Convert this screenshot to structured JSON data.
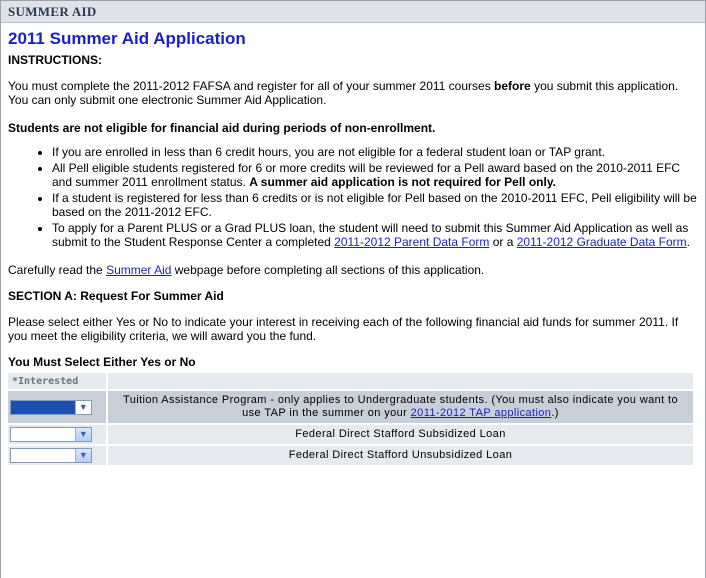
{
  "panel_title": "SUMMER AID",
  "page_title": "2011 Summer Aid Application",
  "instructions_heading": "INSTRUCTIONS:",
  "intro": {
    "part1": "You must complete the 2011-2012 FAFSA and register for all of your summer 2011 courses ",
    "bold": "before",
    "part2": " you submit this application. You can only submit one electronic Summer Aid Application."
  },
  "eligibility_note": "Students are not eligible for financial aid during periods of non-enrollment.",
  "bullets": {
    "b1": "If you are enrolled in less than 6 credit hours, you are not eligible for a federal student loan or TAP grant.",
    "b2_text": "All Pell eligible students registered for 6 or more credits will be reviewed for a Pell award based on the 2010-2011 EFC and summer 2011 enrollment status. ",
    "b2_bold": "A summer aid application is not required for Pell only.",
    "b3": "If a student is registered for less than 6 credits or is not eligible for Pell based on the 2010-2011 EFC, Pell eligibility will be based on the 2011-2012 EFC.",
    "b4_text": "To apply for a Parent PLUS or a Grad PLUS loan, the student will need to submit this Summer Aid Application as well as submit to the Student Response Center a completed ",
    "b4_link1": "2011-2012 Parent Data Form",
    "b4_or": " or a ",
    "b4_link2": "2011-2012 Graduate Data Form",
    "b4_end": "."
  },
  "careful": {
    "before": "Carefully read the ",
    "link": "Summer Aid",
    "after": " webpage before completing all sections of this application."
  },
  "section_a_title": "SECTION A: Request For Summer Aid",
  "section_a_text": "Please select either Yes or No to indicate your interest in receiving each of the following financial aid funds for summer 2011. If you meet the eligibility criteria, we will award you the fund.",
  "must_select": "You Must Select Either Yes or No",
  "table": {
    "col_interested": "*Interested",
    "row1_text": "Tuition Assistance Program - only applies to Undergraduate students. (You must also indicate you want to use TAP in the summer on your ",
    "row1_link": "2011-2012 TAP application",
    "row1_end": ".)",
    "row2_text": "Federal Direct Stafford Subsidized Loan",
    "row3_text": "Federal Direct Stafford Unsubsidized Loan"
  },
  "icons": {
    "dropdown": "chevron-down-icon"
  },
  "colors": {
    "title_blue": "#1a1fc6",
    "header_bg": "#dfe3e8",
    "selected_blue": "#1c4fb0"
  }
}
